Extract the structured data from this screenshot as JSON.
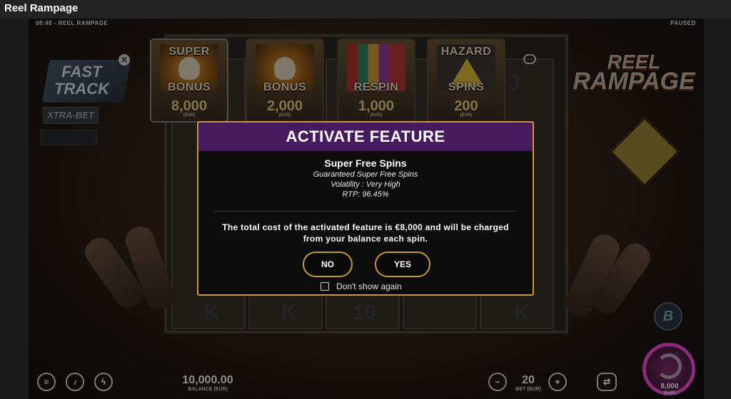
{
  "window": {
    "title": "Reel Rampage"
  },
  "status": {
    "time": "08:48",
    "game_name": "REEL RAMPAGE",
    "state": "PAUSED"
  },
  "logo": {
    "line1": "REEL",
    "line2": "RAMPAGE"
  },
  "left_panel": {
    "fast_track_line1": "FAST",
    "fast_track_line2": "TRACK",
    "close_glyph": "✕",
    "xtra_bet": "XTRA-BET"
  },
  "feature_cards": [
    {
      "title_top": "SUPER",
      "title_bottom": "BONUS",
      "price": "8,000",
      "unit": "(EUR)"
    },
    {
      "title_top": "",
      "title_bottom": "BONUS",
      "price": "2,000",
      "unit": "(EUR)"
    },
    {
      "title_top": "",
      "title_bottom": "RESPIN",
      "price": "1,000",
      "unit": "(EUR)"
    },
    {
      "title_top": "HAZARD",
      "title_bottom": "SPINS",
      "price": "200",
      "unit": "(EUR)"
    }
  ],
  "reel_symbols": {
    "j": "J",
    "k1": "K",
    "k2": "K",
    "k3": "K",
    "ten": "10"
  },
  "modal": {
    "title": "ACTIVATE FEATURE",
    "feature_name": "Super Free Spins",
    "subtitle": "Guaranteed Super Free Spins",
    "volatility": "Volatility : Very High",
    "rtp": "RTP: 96.45%",
    "cost_text": "The total cost of the activated feature is €8,000 and will be charged from your balance each spin.",
    "no_label": "NO",
    "yes_label": "YES",
    "dont_show_label": "Don't show again"
  },
  "bottom_bar": {
    "balance_value": "10,000.00",
    "balance_label": "BALANCE (EUR)",
    "bet_value": "20",
    "bet_label": "BET (EUR)",
    "minus_glyph": "−",
    "plus_glyph": "+",
    "total_value": "8,000",
    "total_label": "(EUR)",
    "b_glyph": "B"
  },
  "icons": [
    "menu-icon",
    "sound-icon",
    "lightning-icon",
    "autoplay-icon",
    "spin-icon",
    "info-icon"
  ]
}
